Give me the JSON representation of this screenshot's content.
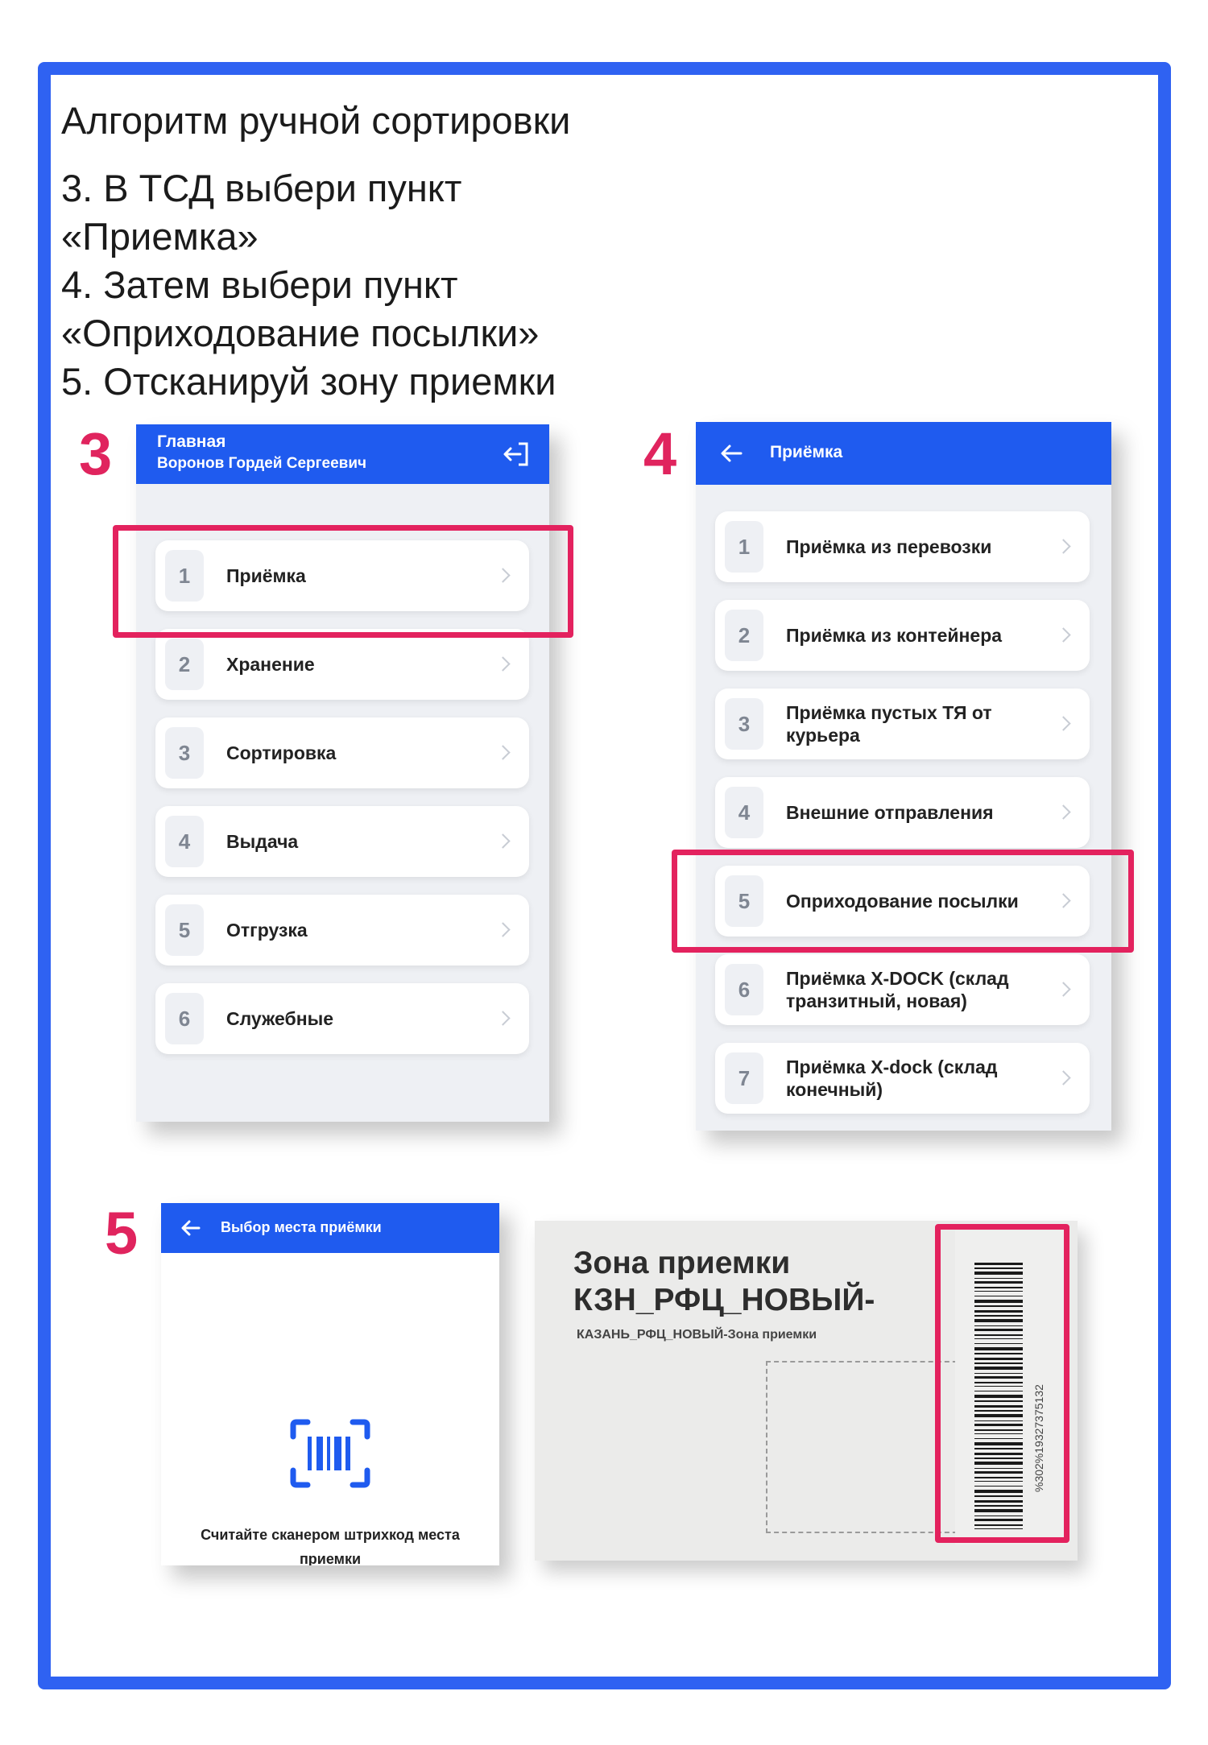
{
  "title": "Алгоритм ручной сортировки",
  "steps": [
    "3. В ТСД выбери пункт",
    "«Приемка»",
    "4. Затем выбери пункт",
    "«Оприходование посылки»",
    "5. Отсканируй зону приемки"
  ],
  "step_markers": [
    "3",
    "4",
    "5"
  ],
  "colors": {
    "frame": "#2f62f2",
    "header": "#1f5bef",
    "highlight": "#e3225e",
    "marker": "#e0245e"
  },
  "screen_main": {
    "title": "Главная",
    "user": "Воронов Гордей Сергеевич",
    "logout_icon": "logout-icon",
    "items": [
      {
        "num": "1",
        "label": "Приёмка"
      },
      {
        "num": "2",
        "label": "Хранение"
      },
      {
        "num": "3",
        "label": "Сортировка"
      },
      {
        "num": "4",
        "label": "Выдача"
      },
      {
        "num": "5",
        "label": "Отгрузка"
      },
      {
        "num": "6",
        "label": "Служебные"
      }
    ]
  },
  "screen_receiving": {
    "title": "Приёмка",
    "back_icon": "arrow-left-icon",
    "items": [
      {
        "num": "1",
        "label": "Приёмка из перевозки"
      },
      {
        "num": "2",
        "label": "Приёмка из контейнера"
      },
      {
        "num": "3",
        "label": "Приёмка пустых ТЯ от курьера"
      },
      {
        "num": "4",
        "label": "Внешние отправления"
      },
      {
        "num": "5",
        "label": "Оприходование посылки"
      },
      {
        "num": "6",
        "label": "Приёмка X-DOCK (склад транзитный, новая)"
      },
      {
        "num": "7",
        "label": "Приёмка X-dock (склад конечный)"
      }
    ]
  },
  "screen_scan": {
    "title": "Выбор места приёмки",
    "back_icon": "arrow-left-icon",
    "scan_icon": "barcode-scan-icon",
    "instruction": "Считайте сканером штрихкод места приемки"
  },
  "zone_label": {
    "title_line1": "Зона приемки",
    "title_line2": "КЗН_РФЦ_НОВЫЙ-",
    "subtitle": "КАЗАНЬ_РФЦ_НОВЫЙ-Зона приемки",
    "barcode_number": "%302%1932737513​2"
  }
}
